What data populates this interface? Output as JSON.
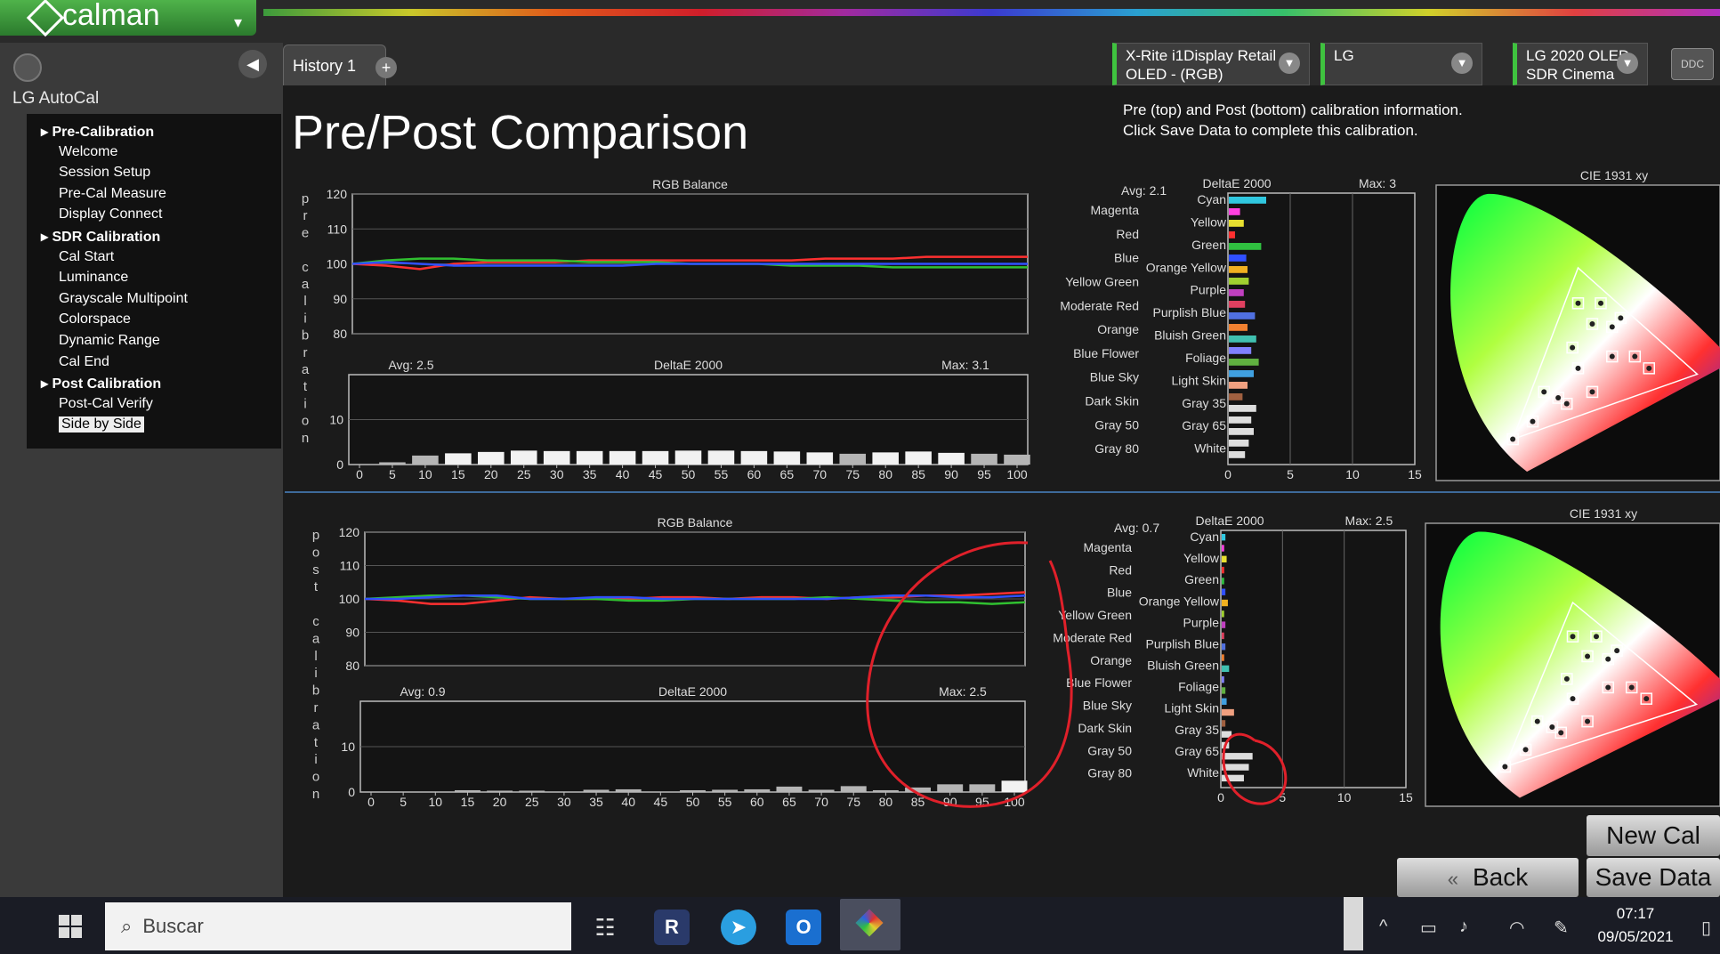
{
  "app": {
    "logo": "calman",
    "dropdown_glyph": "▾"
  },
  "sidebar": {
    "title": "LG AutoCal",
    "tree": [
      {
        "label": "Pre-Calibration",
        "level": 0
      },
      {
        "label": "Welcome",
        "level": 1
      },
      {
        "label": "Session Setup",
        "level": 1
      },
      {
        "label": "Pre-Cal Measure",
        "level": 1
      },
      {
        "label": "Display  Connect",
        "level": 1
      },
      {
        "label": "SDR Calibration",
        "level": 0
      },
      {
        "label": "Cal Start",
        "level": 1
      },
      {
        "label": "Luminance",
        "level": 1
      },
      {
        "label": "Grayscale Multipoint",
        "level": 1
      },
      {
        "label": "Colorspace",
        "level": 1
      },
      {
        "label": "Dynamic Range",
        "level": 1
      },
      {
        "label": "Cal End",
        "level": 1
      },
      {
        "label": "Post Calibration",
        "level": 0
      },
      {
        "label": "Post-Cal Verify",
        "level": 1
      },
      {
        "label": "Side by Side",
        "level": 1,
        "selected": true
      }
    ]
  },
  "tabs": {
    "history": "History 1",
    "add": "+"
  },
  "devices": [
    {
      "line1": "X-Rite i1Display Retail",
      "line2": "OLED - (RGB)"
    },
    {
      "line1": "LG",
      "line2": ""
    },
    {
      "line1": "LG 2020 OLED",
      "line2": "SDR Cinema"
    }
  ],
  "ddc_label": "DDC",
  "page": {
    "title": "Pre/Post Comparison",
    "info_line1": "Pre (top) and Post (bottom) calibration information.",
    "info_line2": "Click Save Data to complete this calibration."
  },
  "vertical_labels": {
    "pre": "pre calibration",
    "post": "post calibration"
  },
  "buttons": {
    "new_cal": "New Cal",
    "back": "Back",
    "save": "Save Data",
    "back_glyph": "«"
  },
  "taskbar": {
    "search": "Buscar",
    "time": "07:17",
    "date": "09/05/2021"
  },
  "colors": {
    "accent_green": "#3fc33f",
    "red_line": "#ff3030",
    "green_line": "#30c030",
    "blue_line": "#3050ff",
    "annotation": "#e0202a"
  },
  "chart_data": [
    {
      "id": "pre-rgb",
      "type": "line",
      "title": "RGB Balance",
      "ylim": [
        80,
        120
      ],
      "yticks": [
        80,
        90,
        100,
        110,
        120
      ],
      "x": [
        0,
        5,
        10,
        15,
        20,
        25,
        30,
        35,
        40,
        45,
        50,
        55,
        60,
        65,
        70,
        75,
        80,
        85,
        90,
        95,
        100
      ],
      "series": [
        {
          "color": "#ff3030",
          "values": [
            100,
            99.5,
            98.5,
            100,
            100.5,
            100.5,
            100.5,
            101,
            101,
            101,
            101,
            101,
            101,
            101,
            101.5,
            101.5,
            101.5,
            102,
            102,
            102,
            102
          ]
        },
        {
          "color": "#30c030",
          "values": [
            100,
            101,
            101.5,
            101.5,
            101,
            101,
            101,
            100.5,
            100.5,
            100.5,
            100,
            100,
            100,
            99.5,
            99.5,
            99.5,
            99,
            99,
            99,
            99,
            99
          ]
        },
        {
          "color": "#3050ff",
          "values": [
            100,
            100.5,
            100,
            99.5,
            99.5,
            99.5,
            99.5,
            99.5,
            99.5,
            100,
            100,
            100,
            100,
            100,
            100,
            100,
            100,
            100,
            100,
            100,
            100
          ]
        }
      ]
    },
    {
      "id": "pre-grayscale-de",
      "type": "bar",
      "title": "DeltaE 2000",
      "avg_label": "Avg: 2.5",
      "max_label": "Max: 3.1",
      "ylim": [
        0,
        20
      ],
      "yticks": [
        0,
        10
      ],
      "categories": [
        "0",
        "5",
        "10",
        "15",
        "20",
        "25",
        "30",
        "35",
        "40",
        "45",
        "50",
        "55",
        "60",
        "65",
        "70",
        "75",
        "80",
        "85",
        "90",
        "95",
        "100"
      ],
      "values": [
        0,
        0.5,
        2.0,
        2.5,
        2.8,
        3.1,
        3.0,
        3.0,
        3.0,
        3.0,
        3.1,
        3.1,
        3.0,
        2.9,
        2.7,
        2.4,
        2.7,
        2.9,
        2.6,
        2.4,
        2.2
      ]
    },
    {
      "id": "pre-color-de",
      "type": "bar",
      "orientation": "horizontal",
      "title": "DeltaE 2000",
      "avg_label": "Avg: 2.1",
      "max_label": "Max: 3",
      "xlim": [
        0,
        15
      ],
      "xticks": [
        0,
        5,
        10,
        15
      ],
      "labels_left": [
        "Magenta",
        "Red",
        "Blue",
        "Yellow Green",
        "Moderate Red",
        "Orange",
        "Blue Flower",
        "Blue Sky",
        "Dark Skin",
        "Gray 50",
        "Gray 80"
      ],
      "categories": [
        "Cyan",
        "Yellow",
        "Green",
        "Orange Yellow",
        "Purple",
        "Purplish Blue",
        "Bluish Green",
        "Foliage",
        "Light Skin",
        "Gray 35",
        "Gray 65",
        "White"
      ],
      "bars": [
        {
          "value": 3.0,
          "color": "#30c8e0"
        },
        {
          "value": 0.9,
          "color": "#ff40e0"
        },
        {
          "value": 1.2,
          "color": "#e8e030"
        },
        {
          "value": 0.5,
          "color": "#ff3030"
        },
        {
          "value": 2.6,
          "color": "#30c040"
        },
        {
          "value": 1.4,
          "color": "#3050ff"
        },
        {
          "value": 1.5,
          "color": "#f0b020"
        },
        {
          "value": 1.6,
          "color": "#a0d030"
        },
        {
          "value": 1.2,
          "color": "#c040c0"
        },
        {
          "value": 1.3,
          "color": "#e04060"
        },
        {
          "value": 2.1,
          "color": "#5070e0"
        },
        {
          "value": 1.5,
          "color": "#f08030"
        },
        {
          "value": 2.2,
          "color": "#40c0b0"
        },
        {
          "value": 1.8,
          "color": "#8080ff"
        },
        {
          "value": 2.4,
          "color": "#60b040"
        },
        {
          "value": 2.0,
          "color": "#40a0e0"
        },
        {
          "value": 1.5,
          "color": "#f0a080"
        },
        {
          "value": 1.1,
          "color": "#a06040"
        },
        {
          "value": 2.2,
          "color": "#dddddd"
        },
        {
          "value": 1.8,
          "color": "#dddddd"
        },
        {
          "value": 2.0,
          "color": "#dddddd"
        },
        {
          "value": 1.6,
          "color": "#dddddd"
        },
        {
          "value": 1.3,
          "color": "#dddddd"
        }
      ]
    },
    {
      "id": "pre-cie",
      "type": "scatter",
      "title": "CIE 1931 xy"
    },
    {
      "id": "post-rgb",
      "type": "line",
      "title": "RGB Balance",
      "ylim": [
        80,
        120
      ],
      "yticks": [
        80,
        90,
        100,
        110,
        120
      ],
      "x": [
        0,
        5,
        10,
        15,
        20,
        25,
        30,
        35,
        40,
        45,
        50,
        55,
        60,
        65,
        70,
        75,
        80,
        85,
        90,
        95,
        100
      ],
      "series": [
        {
          "color": "#ff3030",
          "values": [
            100,
            99.5,
            98.5,
            98.5,
            99.5,
            100.5,
            100,
            100,
            100,
            100.5,
            100.5,
            100,
            100.5,
            100.5,
            100,
            100.5,
            100.5,
            101,
            101,
            101.5,
            102
          ]
        },
        {
          "color": "#30c030",
          "values": [
            100,
            100.5,
            101,
            101,
            100.5,
            100,
            100,
            100,
            99.5,
            99.5,
            100,
            100,
            100,
            100,
            100.5,
            100,
            99.5,
            99,
            99,
            98.5,
            99
          ]
        },
        {
          "color": "#3050ff",
          "values": [
            100,
            100,
            100.5,
            101,
            101,
            100,
            100,
            100.5,
            100.5,
            100,
            100,
            100,
            100,
            100,
            100,
            100.5,
            101,
            101,
            100.5,
            100.5,
            101
          ]
        }
      ]
    },
    {
      "id": "post-grayscale-de",
      "type": "bar",
      "title": "DeltaE 2000",
      "avg_label": "Avg: 0.9",
      "max_label": "Max: 2.5",
      "ylim": [
        0,
        20
      ],
      "yticks": [
        0,
        10
      ],
      "categories": [
        "0",
        "5",
        "10",
        "15",
        "20",
        "25",
        "30",
        "35",
        "40",
        "45",
        "50",
        "55",
        "60",
        "65",
        "70",
        "75",
        "80",
        "85",
        "90",
        "95",
        "100"
      ],
      "values": [
        0,
        0,
        0,
        0.4,
        0.3,
        0.3,
        0,
        0.5,
        0.6,
        0,
        0.4,
        0.5,
        0.6,
        1.2,
        0.5,
        1.3,
        0.4,
        1.0,
        1.7,
        1.7,
        2.5
      ]
    },
    {
      "id": "post-color-de",
      "type": "bar",
      "orientation": "horizontal",
      "title": "DeltaE 2000",
      "avg_label": "Avg: 0.7",
      "max_label": "Max: 2.5",
      "xlim": [
        0,
        15
      ],
      "xticks": [
        0,
        5,
        10,
        15
      ],
      "labels_left": [
        "Magenta",
        "Red",
        "Blue",
        "Yellow Green",
        "Moderate Red",
        "Orange",
        "Blue Flower",
        "Blue Sky",
        "Dark Skin",
        "Gray 50",
        "Gray 80"
      ],
      "categories": [
        "Cyan",
        "Yellow",
        "Green",
        "Orange Yellow",
        "Purple",
        "Purplish Blue",
        "Bluish Green",
        "Foliage",
        "Light Skin",
        "Gray 35",
        "Gray 65",
        "White"
      ],
      "bars": [
        {
          "value": 0.3,
          "color": "#30c8e0"
        },
        {
          "value": 0.2,
          "color": "#ff40e0"
        },
        {
          "value": 0.4,
          "color": "#e8e030"
        },
        {
          "value": 0.2,
          "color": "#ff3030"
        },
        {
          "value": 0.2,
          "color": "#30c040"
        },
        {
          "value": 0.3,
          "color": "#3050ff"
        },
        {
          "value": 0.5,
          "color": "#f0b020"
        },
        {
          "value": 0.2,
          "color": "#a0d030"
        },
        {
          "value": 0.3,
          "color": "#c040c0"
        },
        {
          "value": 0.2,
          "color": "#e04060"
        },
        {
          "value": 0.3,
          "color": "#5070e0"
        },
        {
          "value": 0.2,
          "color": "#f08030"
        },
        {
          "value": 0.6,
          "color": "#40c0b0"
        },
        {
          "value": 0.2,
          "color": "#8080ff"
        },
        {
          "value": 0.3,
          "color": "#60b040"
        },
        {
          "value": 0.4,
          "color": "#40a0e0"
        },
        {
          "value": 1.0,
          "color": "#f0a080"
        },
        {
          "value": 0.3,
          "color": "#a06040"
        },
        {
          "value": 0.8,
          "color": "#dddddd"
        },
        {
          "value": 0.6,
          "color": "#dddddd"
        },
        {
          "value": 2.5,
          "color": "#dddddd"
        },
        {
          "value": 2.2,
          "color": "#dddddd"
        },
        {
          "value": 1.8,
          "color": "#dddddd"
        }
      ]
    },
    {
      "id": "post-cie",
      "type": "scatter",
      "title": "CIE 1931 xy"
    }
  ]
}
